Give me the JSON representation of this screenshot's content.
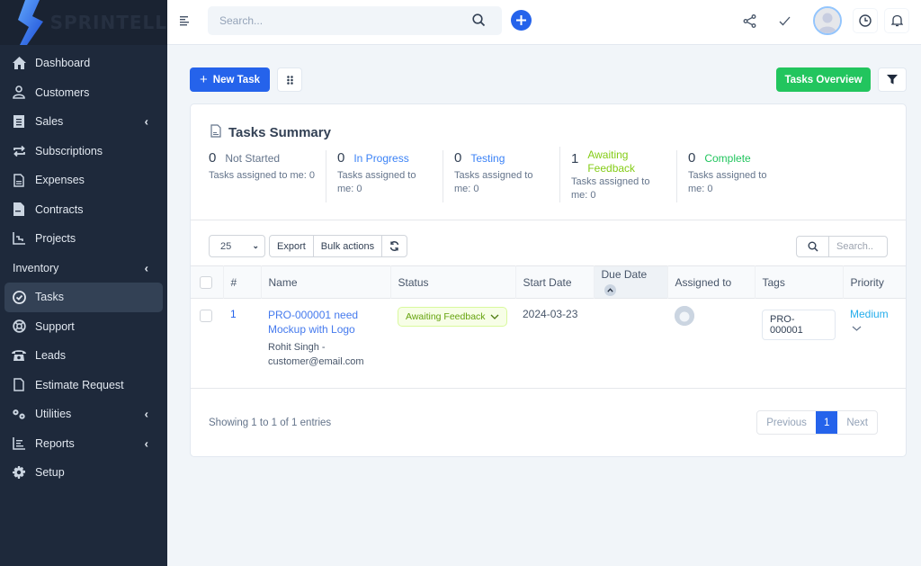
{
  "brand": {
    "name": "SPRINTELL"
  },
  "sidebar": {
    "items": [
      {
        "label": "Dashboard",
        "icon": "home-icon"
      },
      {
        "label": "Customers",
        "icon": "user-icon"
      },
      {
        "label": "Sales",
        "icon": "receipt-icon",
        "has_submenu": true
      },
      {
        "label": "Subscriptions",
        "icon": "repeat-icon"
      },
      {
        "label": "Expenses",
        "icon": "file-text-icon"
      },
      {
        "label": "Contracts",
        "icon": "contract-icon"
      },
      {
        "label": "Projects",
        "icon": "chart-icon"
      },
      {
        "label": "Inventory",
        "icon": null,
        "has_submenu": true
      },
      {
        "label": "Tasks",
        "icon": "check-circle-icon",
        "active": true
      },
      {
        "label": "Support",
        "icon": "lifebuoy-icon"
      },
      {
        "label": "Leads",
        "icon": "phone-icon"
      },
      {
        "label": "Estimate Request",
        "icon": "file-icon"
      },
      {
        "label": "Utilities",
        "icon": "cogs-icon",
        "has_submenu": true
      },
      {
        "label": "Reports",
        "icon": "bar-chart-icon",
        "has_submenu": true
      },
      {
        "label": "Setup",
        "icon": "gear-icon"
      }
    ]
  },
  "header": {
    "search_placeholder": "Search..."
  },
  "toolbar": {
    "new_task_label": "New Task",
    "tasks_overview_label": "Tasks Overview"
  },
  "summary": {
    "title": "Tasks Summary",
    "items": [
      {
        "count": "0",
        "label": "Not Started",
        "sub": "Tasks assigned to me: 0",
        "color": "#64748b"
      },
      {
        "count": "0",
        "label": "In Progress",
        "sub": "Tasks assigned to me: 0",
        "color": "#3b82f6"
      },
      {
        "count": "0",
        "label": "Testing",
        "sub": "Tasks assigned to me: 0",
        "color": "#3b82f6"
      },
      {
        "count": "1",
        "label": "Awaiting Feedback",
        "sub": "Tasks assigned to me: 0",
        "color": "#84cc16"
      },
      {
        "count": "0",
        "label": "Complete",
        "sub": "Tasks assigned to me: 0",
        "color": "#22c55e"
      }
    ]
  },
  "table_controls": {
    "page_size": "25",
    "export_label": "Export",
    "bulk_label": "Bulk actions",
    "search_placeholder": "Search.."
  },
  "table": {
    "columns": [
      "#",
      "Name",
      "Status",
      "Start Date",
      "Due Date",
      "Assigned to",
      "Tags",
      "Priority"
    ],
    "rows": [
      {
        "id": "1",
        "name": "PRO-000001 need Mockup with Logo",
        "customer": "Rohit Singh - customer@email.com",
        "status": "Awaiting Feedback",
        "start_date": "2024-03-23",
        "due_date": "",
        "tag": "PRO-000001",
        "priority": "Medium"
      }
    ]
  },
  "footer": {
    "entries_text": "Showing 1 to 1 of 1 entries",
    "prev_label": "Previous",
    "current_page": "1",
    "next_label": "Next"
  }
}
